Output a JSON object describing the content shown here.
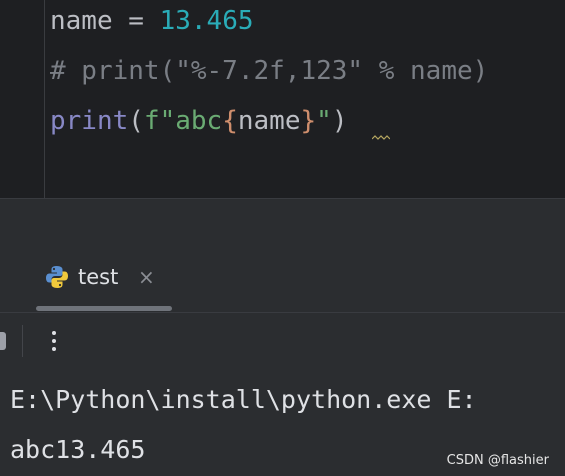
{
  "editor": {
    "line1": {
      "ident": "name",
      "op": " = ",
      "number": "13.465"
    },
    "line2": {
      "comment": "# print(\"%-7.2f,123\" % name)"
    },
    "line3": {
      "func": "print",
      "open_paren": "(",
      "fstring_open": "f\"abc",
      "brace_open": "{",
      "var": "name",
      "brace_close": "}",
      "fstring_close": "\"",
      "close_paren": ")"
    }
  },
  "run_panel": {
    "tab_label": "test",
    "tab_close_glyph": "×",
    "tab_icon": "python-icon"
  },
  "toolbar": {
    "more_icon": "more-vertical-icon"
  },
  "console": {
    "lines": [
      "E:\\Python\\install\\python.exe E:",
      "abc13.465"
    ]
  },
  "watermark": "CSDN @flashier",
  "colors": {
    "editor_bg": "#1e1f22",
    "panel_bg": "#2b2d30",
    "number": "#2aacb8",
    "string": "#6aab73",
    "comment": "#7a7e85",
    "builtin": "#8888c6",
    "brace": "#cf8e6d",
    "text": "#bcbec4"
  }
}
